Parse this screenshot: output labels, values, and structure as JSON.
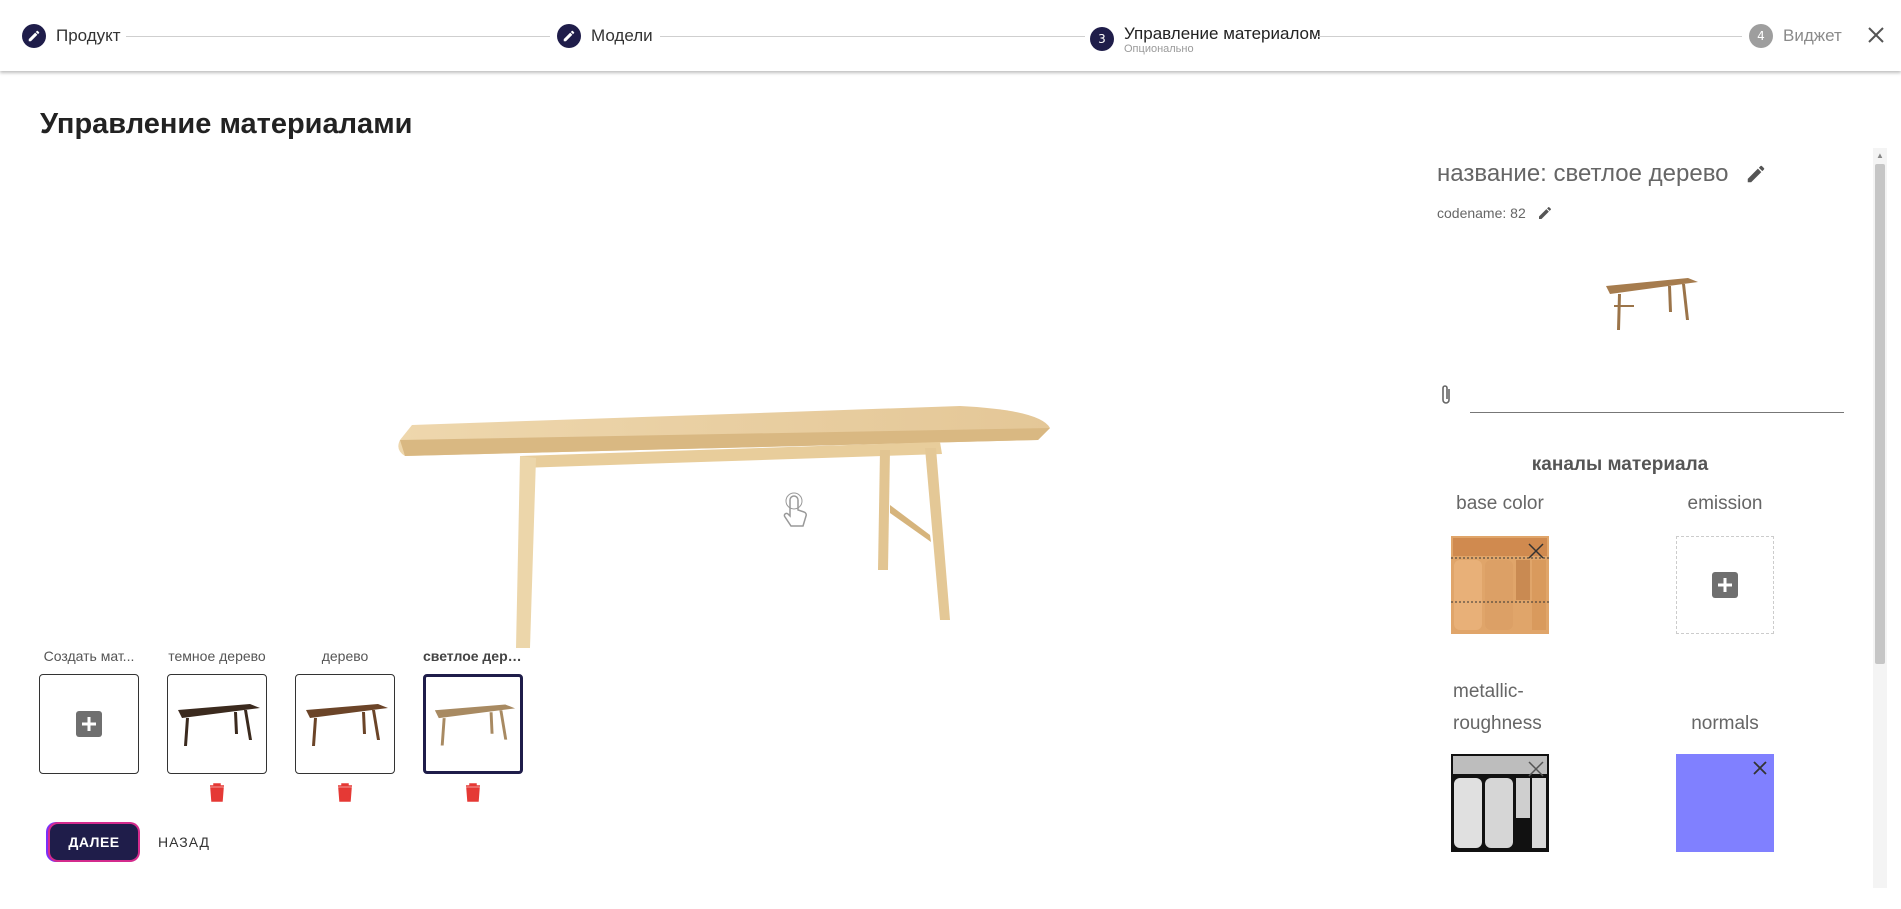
{
  "stepper": {
    "steps": [
      {
        "label": "Продукт",
        "icon": "pencil-icon"
      },
      {
        "label": "Модели",
        "icon": "pencil-icon"
      },
      {
        "number": "3",
        "label": "Управление материалом",
        "sublabel": "Опционально"
      },
      {
        "number": "4",
        "label": "Виджет"
      }
    ]
  },
  "page": {
    "title": "Управление материалами"
  },
  "materials": {
    "create_label": "Создать мат...",
    "items": [
      {
        "label": "темное дерево",
        "color": "#3b2a1e"
      },
      {
        "label": "дерево",
        "color": "#6b4428"
      },
      {
        "label": "светлое дере...",
        "color": "#a88a62"
      }
    ]
  },
  "buttons": {
    "next": "ДАЛЕЕ",
    "back": "НАЗАД"
  },
  "panel": {
    "name": "название: светлое дерево",
    "codename": "codename: 82",
    "file_value": "",
    "channels_title": "каналы материала",
    "channels": {
      "base_color": "base color",
      "emission": "emission",
      "metallic_line1": "metallic-",
      "metallic_line2": "roughness",
      "normals": "normals"
    }
  },
  "colors": {
    "accent": "#1f1d4a",
    "delete": "#e53935",
    "wood_light": "#e8cfa0",
    "normals": "#8080ff"
  }
}
